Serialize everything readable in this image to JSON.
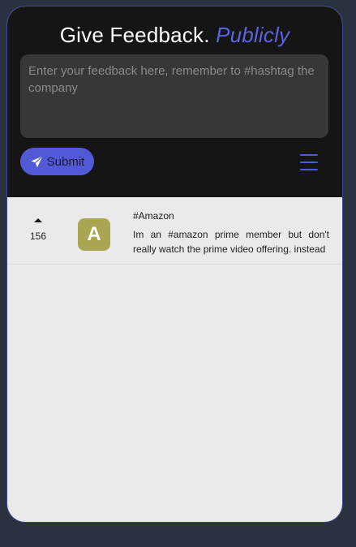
{
  "header": {
    "title_main": "Give Feedback.",
    "title_accent": "Publicly",
    "feedback_placeholder": "Enter your feedback here, remember to #hashtag the company",
    "submit_label": "Submit",
    "submit_icon": "paper-plane-icon",
    "menu_icon": "hamburger-menu-icon"
  },
  "colors": {
    "accent": "#5159d6",
    "header_bg": "#151515",
    "list_bg": "#eaeaeb",
    "avatar_bg": "#a9a552"
  },
  "feedback_items": [
    {
      "upvotes": "156",
      "avatar_letter": "A",
      "company_tag": "#Amazon",
      "text": "Im an #amazon prime member but don't really watch the prime video offering. instead"
    }
  ]
}
